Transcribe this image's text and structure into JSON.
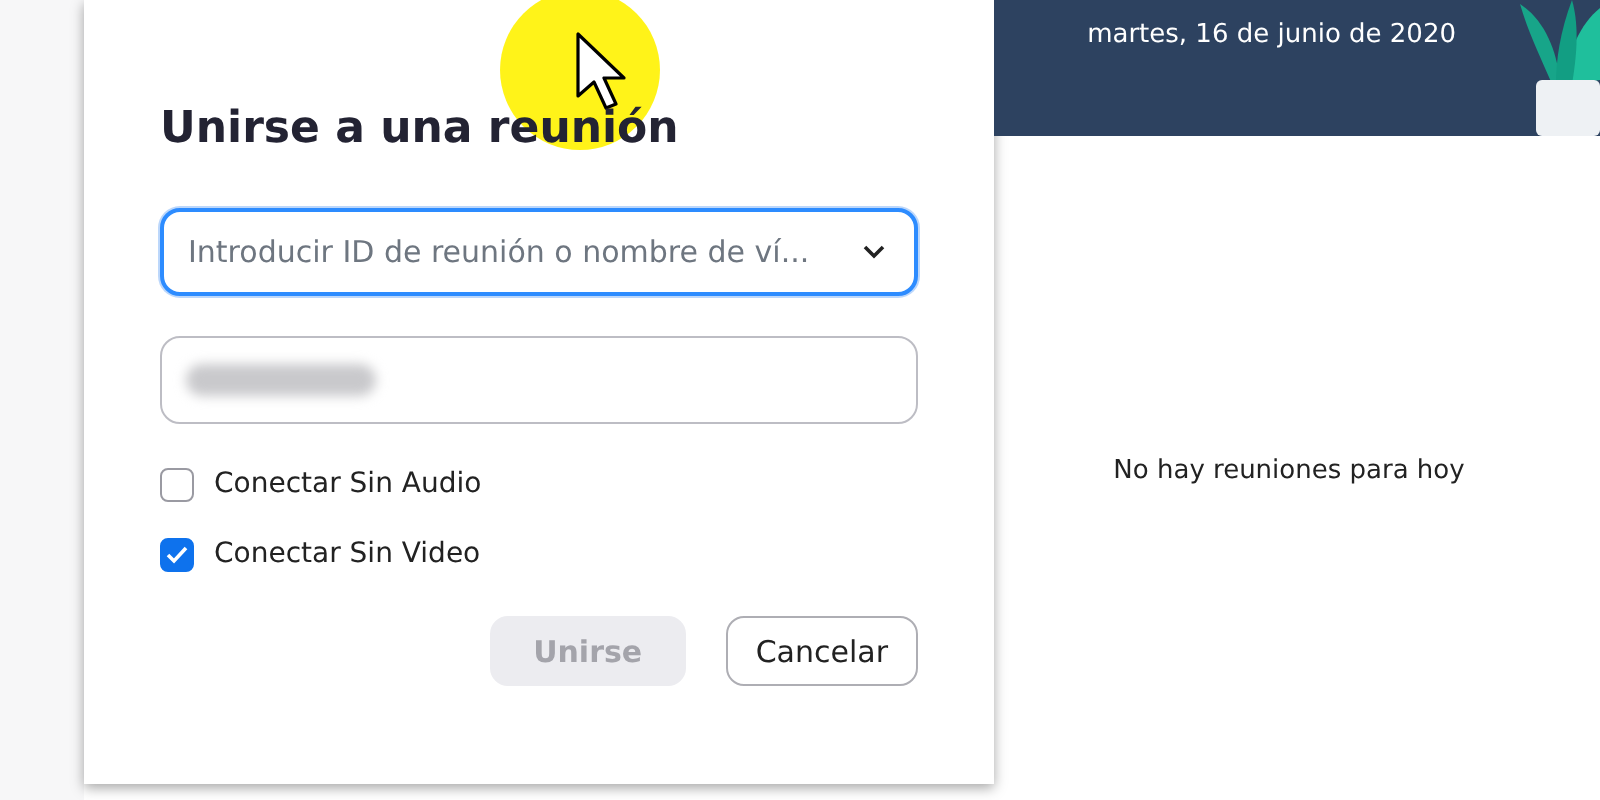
{
  "dialog": {
    "title": "Unirse a una reunión",
    "meeting_field": {
      "placeholder": "Introducir ID de reunión o nombre de ví...",
      "focused": true
    },
    "name_field": {
      "blurred": true
    },
    "options": [
      {
        "label": "Conectar Sin Audio",
        "checked": false
      },
      {
        "label": "Conectar Sin Video",
        "checked": true
      }
    ],
    "buttons": [
      {
        "label": "Unirse",
        "kind": "primary",
        "disabled": true
      },
      {
        "label": "Cancelar",
        "kind": "secondary",
        "disabled": false
      }
    ]
  },
  "main": {
    "date": "martes, 16 de junio de 2020",
    "empty_message": "No hay reuniones para hoy"
  }
}
